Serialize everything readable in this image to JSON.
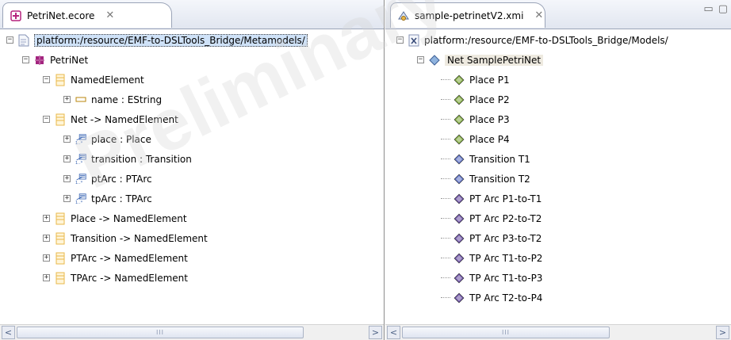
{
  "left_editor": {
    "tab_title": "PetriNet.ecore",
    "close_glyph": "✕",
    "resource_path": "platform:/resource/EMF-to-DSLTools_Bridge/Metamodels/",
    "tree": [
      {
        "label": "PetriNet",
        "icon": "package-icon",
        "toggle": "−"
      },
      {
        "label": "NamedElement",
        "icon": "eclass-icon",
        "toggle": "−"
      },
      {
        "label": "name : EString",
        "icon": "eattribute-icon",
        "toggle": "+"
      },
      {
        "label": "Net -> NamedElement",
        "icon": "eclass-icon",
        "toggle": "−"
      },
      {
        "label": "place : Place",
        "icon": "ereference-icon",
        "toggle": "+"
      },
      {
        "label": "transition : Transition",
        "icon": "ereference-icon",
        "toggle": "+"
      },
      {
        "label": "ptArc : PTArc",
        "icon": "ereference-icon",
        "toggle": "+"
      },
      {
        "label": "tpArc : TPArc",
        "icon": "ereference-icon",
        "toggle": "+"
      },
      {
        "label": "Place -> NamedElement",
        "icon": "eclass-icon",
        "toggle": "+"
      },
      {
        "label": "Transition -> NamedElement",
        "icon": "eclass-icon",
        "toggle": "+"
      },
      {
        "label": "PTArc -> NamedElement",
        "icon": "eclass-icon",
        "toggle": "+"
      },
      {
        "label": "TPArc -> NamedElement",
        "icon": "eclass-icon",
        "toggle": "+"
      }
    ]
  },
  "right_editor": {
    "tab_title": "sample-petrinetV2.xmi",
    "close_glyph": "✕",
    "resource_path": "platform:/resource/EMF-to-DSLTools_Bridge/Models/",
    "root_node": "Net SamplePetriNet",
    "items": [
      {
        "label": "Place P1",
        "icon": "place-node-icon"
      },
      {
        "label": "Place P2",
        "icon": "place-node-icon"
      },
      {
        "label": "Place P3",
        "icon": "place-node-icon"
      },
      {
        "label": "Place P4",
        "icon": "place-node-icon"
      },
      {
        "label": "Transition T1",
        "icon": "transition-node-icon"
      },
      {
        "label": "Transition T2",
        "icon": "transition-node-icon"
      },
      {
        "label": "PT Arc P1-to-T1",
        "icon": "arc-node-icon"
      },
      {
        "label": "PT Arc P2-to-T2",
        "icon": "arc-node-icon"
      },
      {
        "label": "PT Arc P3-to-T2",
        "icon": "arc-node-icon"
      },
      {
        "label": "TP Arc T1-to-P2",
        "icon": "arc-node-icon"
      },
      {
        "label": "TP Arc T1-to-P3",
        "icon": "arc-node-icon"
      },
      {
        "label": "TP Arc T2-to-P4",
        "icon": "arc-node-icon"
      }
    ]
  },
  "scroll_glyphs": {
    "left": "<",
    "right": ">",
    "grip": "III"
  },
  "window_controls": {
    "minimize": "▭",
    "maximize": "▢"
  },
  "watermark_text": "Preliminary V",
  "colors": {
    "selection": "#cfe2f8",
    "eclass": "#e8b84a",
    "package": "#a3247f",
    "place_node": "#7ea83c",
    "transition_node": "#5b6fc3",
    "arc_node": "#6a4fa3"
  }
}
